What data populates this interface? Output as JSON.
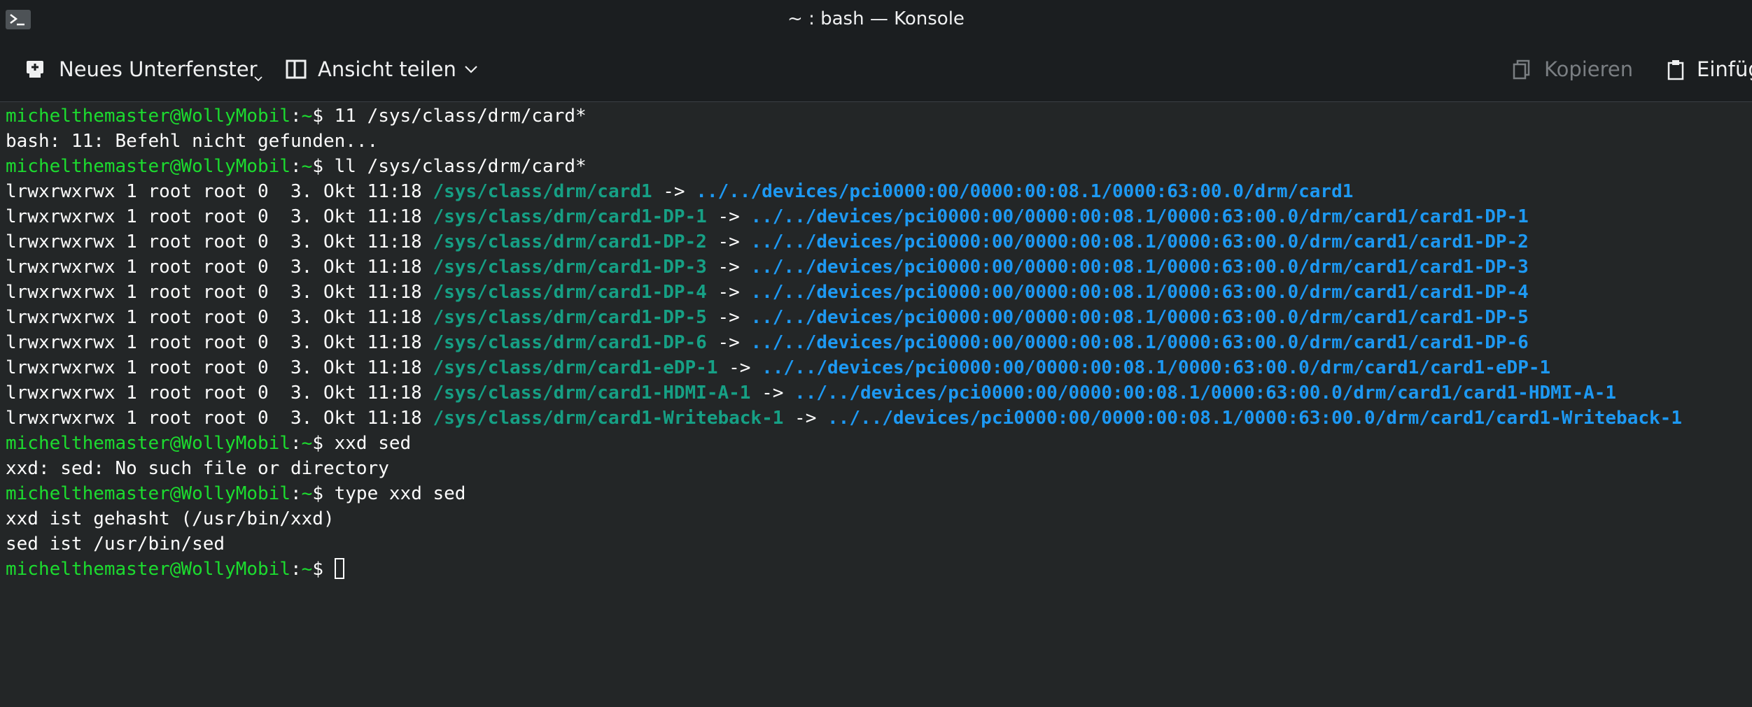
{
  "window": {
    "title": "~ : bash — Konsole"
  },
  "toolbar": {
    "new_tab": "Neues Unterfenster",
    "split_view": "Ansicht teilen",
    "copy": "Kopieren",
    "paste": "Einfüg"
  },
  "prompt": {
    "user_host": "michelthemaster@WollyMobil",
    "colon": ":",
    "tilde": "~",
    "dollar": "$ "
  },
  "lines": [
    {
      "type": "prompt",
      "cmd": "11 /sys/class/drm/card*"
    },
    {
      "type": "out",
      "text": "bash: 11: Befehl nicht gefunden..."
    },
    {
      "type": "prompt",
      "cmd": "ll /sys/class/drm/card*"
    },
    {
      "type": "link",
      "meta": "lrwxrwxrwx 1 root root 0  3. Okt 11:18 ",
      "name": "/sys/class/drm/card1",
      "arrow": " -> ",
      "target": "../../devices/pci0000:00/0000:00:08.1/0000:63:00.0/drm/card1"
    },
    {
      "type": "link",
      "meta": "lrwxrwxrwx 1 root root 0  3. Okt 11:18 ",
      "name": "/sys/class/drm/card1-DP-1",
      "arrow": " -> ",
      "target": "../../devices/pci0000:00/0000:00:08.1/0000:63:00.0/drm/card1/card1-DP-1"
    },
    {
      "type": "link",
      "meta": "lrwxrwxrwx 1 root root 0  3. Okt 11:18 ",
      "name": "/sys/class/drm/card1-DP-2",
      "arrow": " -> ",
      "target": "../../devices/pci0000:00/0000:00:08.1/0000:63:00.0/drm/card1/card1-DP-2"
    },
    {
      "type": "link",
      "meta": "lrwxrwxrwx 1 root root 0  3. Okt 11:18 ",
      "name": "/sys/class/drm/card1-DP-3",
      "arrow": " -> ",
      "target": "../../devices/pci0000:00/0000:00:08.1/0000:63:00.0/drm/card1/card1-DP-3"
    },
    {
      "type": "link",
      "meta": "lrwxrwxrwx 1 root root 0  3. Okt 11:18 ",
      "name": "/sys/class/drm/card1-DP-4",
      "arrow": " -> ",
      "target": "../../devices/pci0000:00/0000:00:08.1/0000:63:00.0/drm/card1/card1-DP-4"
    },
    {
      "type": "link",
      "meta": "lrwxrwxrwx 1 root root 0  3. Okt 11:18 ",
      "name": "/sys/class/drm/card1-DP-5",
      "arrow": " -> ",
      "target": "../../devices/pci0000:00/0000:00:08.1/0000:63:00.0/drm/card1/card1-DP-5"
    },
    {
      "type": "link",
      "meta": "lrwxrwxrwx 1 root root 0  3. Okt 11:18 ",
      "name": "/sys/class/drm/card1-DP-6",
      "arrow": " -> ",
      "target": "../../devices/pci0000:00/0000:00:08.1/0000:63:00.0/drm/card1/card1-DP-6"
    },
    {
      "type": "link",
      "meta": "lrwxrwxrwx 1 root root 0  3. Okt 11:18 ",
      "name": "/sys/class/drm/card1-eDP-1",
      "arrow": " -> ",
      "target": "../../devices/pci0000:00/0000:00:08.1/0000:63:00.0/drm/card1/card1-eDP-1"
    },
    {
      "type": "link",
      "meta": "lrwxrwxrwx 1 root root 0  3. Okt 11:18 ",
      "name": "/sys/class/drm/card1-HDMI-A-1",
      "arrow": " -> ",
      "target": "../../devices/pci0000:00/0000:00:08.1/0000:63:00.0/drm/card1/card1-HDMI-A-1"
    },
    {
      "type": "link",
      "meta": "lrwxrwxrwx 1 root root 0  3. Okt 11:18 ",
      "name": "/sys/class/drm/card1-Writeback-1",
      "arrow": " -> ",
      "target": "../../devices/pci0000:00/0000:00:08.1/0000:63:00.0/drm/card1/card1-Writeback-1"
    },
    {
      "type": "prompt",
      "cmd": "xxd sed"
    },
    {
      "type": "out",
      "text": "xxd: sed: No such file or directory"
    },
    {
      "type": "prompt",
      "cmd": "type xxd sed"
    },
    {
      "type": "out",
      "text": "xxd ist gehasht (/usr/bin/xxd)"
    },
    {
      "type": "out",
      "text": "sed ist /usr/bin/sed"
    },
    {
      "type": "prompt",
      "cmd": "",
      "cursor": true
    }
  ]
}
